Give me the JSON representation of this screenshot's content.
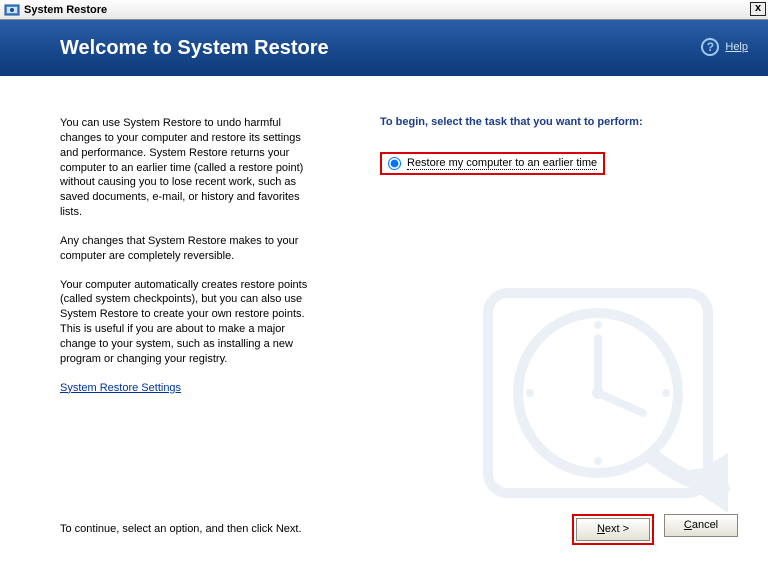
{
  "titlebar": {
    "title": "System Restore",
    "close": "x"
  },
  "header": {
    "title": "Welcome to System Restore",
    "help_label": "Help",
    "help_glyph": "?"
  },
  "left": {
    "p1": "You can use System Restore to undo harmful changes to your computer and restore its settings and performance. System Restore returns your computer to an earlier time (called a restore point) without causing you to lose recent work, such as saved documents, e-mail, or history and favorites lists.",
    "p2": "Any changes that System Restore makes to your computer are completely reversible.",
    "p3": "Your computer automatically creates restore points (called system checkpoints), but you can also use System Restore to create your own restore points. This is useful if you are about to make a major change to your system, such as installing a new program or changing your registry.",
    "settings_link": "System Restore Settings"
  },
  "right": {
    "prompt": "To begin, select the task that you want to perform:",
    "option_restore": "Restore my computer to an earlier time"
  },
  "footer": {
    "continue_text": "To continue, select an option, and then click Next.",
    "next_label_pre": "",
    "next_label_u": "N",
    "next_label_post": "ext >",
    "cancel_label_u": "C",
    "cancel_label_post": "ancel"
  }
}
